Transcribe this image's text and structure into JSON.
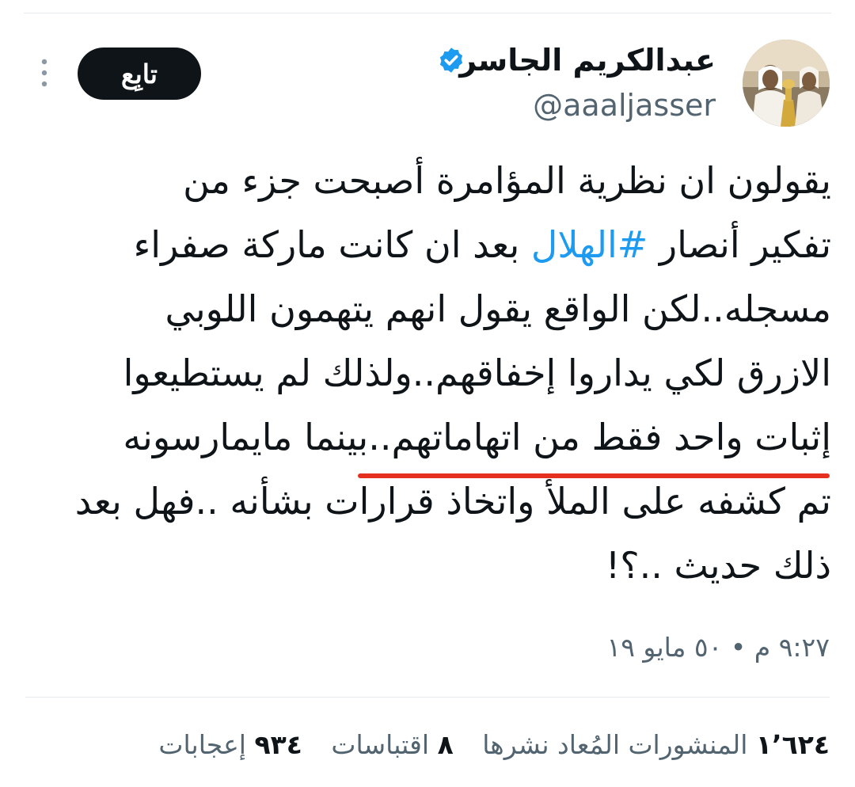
{
  "author": {
    "display_name": "عبدالكريم الجاسر",
    "handle": "@aaaljasser",
    "verified": true,
    "avatar_icon": "profile-photo"
  },
  "follow_label": "تابِع",
  "more_icon": "more-vertical-icon",
  "tweet": {
    "line1": "يقولون ان نظرية المؤامرة أصبحت جزء من",
    "line2_before": "تفكير أنصار ",
    "line2_hashtag": "#الهلال",
    "line2_after": " بعد ان كانت ماركة صفراء",
    "line3": "مسجله..لكن الواقع يقول انهم يتهمون اللوبي",
    "line4": "الازرق لكي يداروا إخفاقهم..ولذلك لم يستطيعوا",
    "line5": "إثبات واحد فقط من اتهاماتهم..بينما مايمارسونه",
    "line6": "تم كشفه على الملأ واتخاذ قرارات بشأنه ..فهل بعد",
    "line7": "ذلك حديث ..؟!"
  },
  "timestamp": "٩:٢٧ م • ٥٠ مايو ١٩",
  "stats": {
    "reposts_count": "١٬٦٢٤",
    "reposts_label": "المنشورات المُعاد نشرها",
    "quotes_count": "٨",
    "quotes_label": "اقتباسات",
    "likes_count": "٩٣٤",
    "likes_label": "إعجابات"
  },
  "colors": {
    "text": "#0f1419",
    "secondary": "#536471",
    "link": "#1d9bf0",
    "verified": "#1d9bf0",
    "underline": "#e6301f"
  }
}
